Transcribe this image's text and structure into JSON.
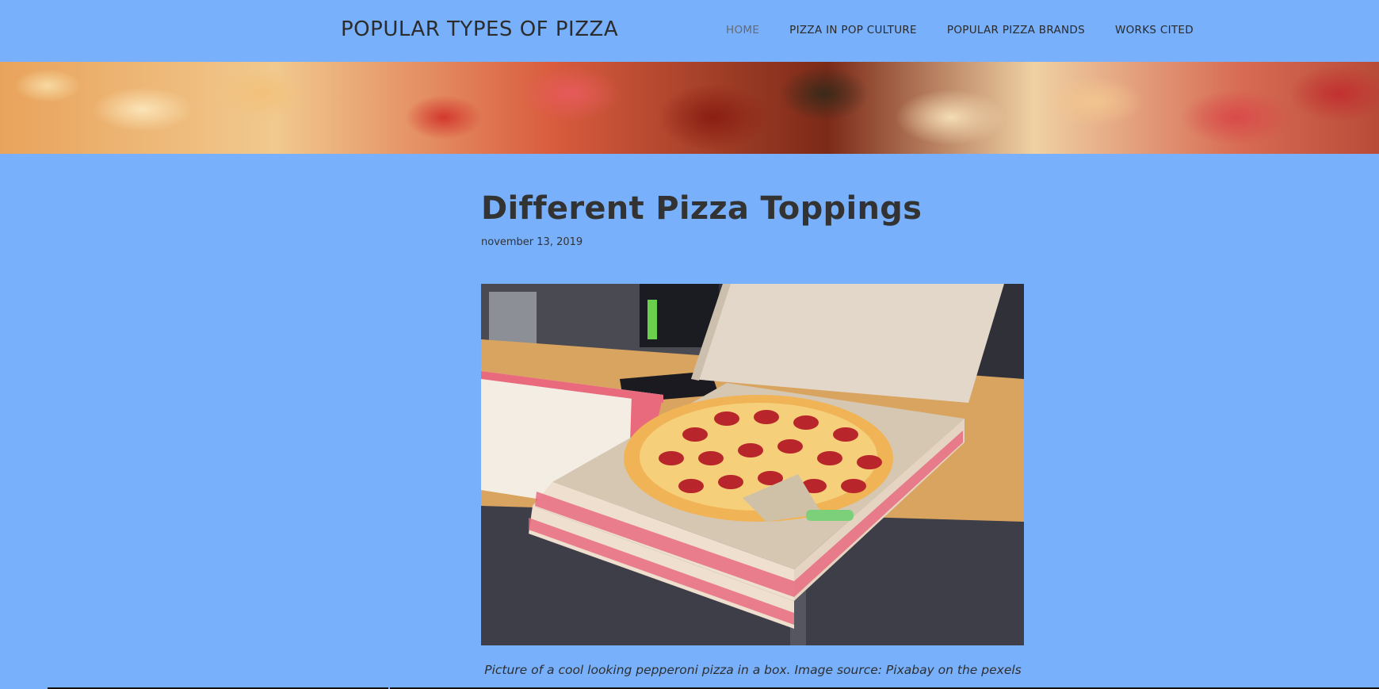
{
  "header": {
    "site_title": "POPULAR TYPES OF PIZZA",
    "nav": [
      {
        "label": "HOME",
        "active": true
      },
      {
        "label": "PIZZA IN POP CULTURE",
        "active": false
      },
      {
        "label": "POPULAR PIZZA BRANDS",
        "active": false
      },
      {
        "label": "WORKS CITED",
        "active": false
      }
    ]
  },
  "post": {
    "title": "Different Pizza Toppings",
    "date": "november 13, 2019",
    "caption": "Picture of a cool looking pepperoni pizza in a box. Image source: Pixabay on the pexels"
  },
  "colors": {
    "background": "#78b0fb",
    "text": "#333333",
    "nav_active": "#666a72"
  }
}
